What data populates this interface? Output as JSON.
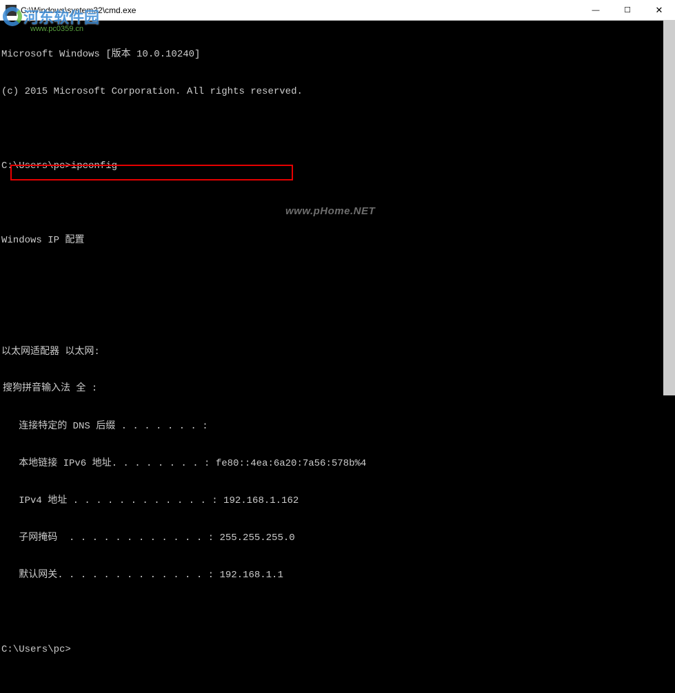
{
  "titlebar": {
    "title": "C:\\Windows\\system32\\cmd.exe",
    "minimize": "—",
    "maximize": "☐",
    "close": "✕"
  },
  "watermark": {
    "logo_text": "河东软件园",
    "logo_sub": "www.pc0359.cn",
    "url": "www.pHome.NET"
  },
  "terminal": {
    "lines": [
      "Microsoft Windows [版本 10.0.10240]",
      "(c) 2015 Microsoft Corporation. All rights reserved.",
      "",
      "C:\\Users\\pc>ipconfig",
      "",
      "Windows IP 配置",
      "",
      "",
      "以太网适配器 以太网:",
      "",
      "   连接特定的 DNS 后缀 . . . . . . . :",
      "   本地链接 IPv6 地址. . . . . . . . : fe80::4ea:6a20:7a56:578b%4",
      "   IPv4 地址 . . . . . . . . . . . . : 192.168.1.162",
      "   子网掩码  . . . . . . . . . . . . : 255.255.255.0",
      "   默认网关. . . . . . . . . . . . . : 192.168.1.1",
      "",
      "C:\\Users\\pc>"
    ]
  },
  "ime": {
    "status": "搜狗拼音输入法 全 :"
  }
}
